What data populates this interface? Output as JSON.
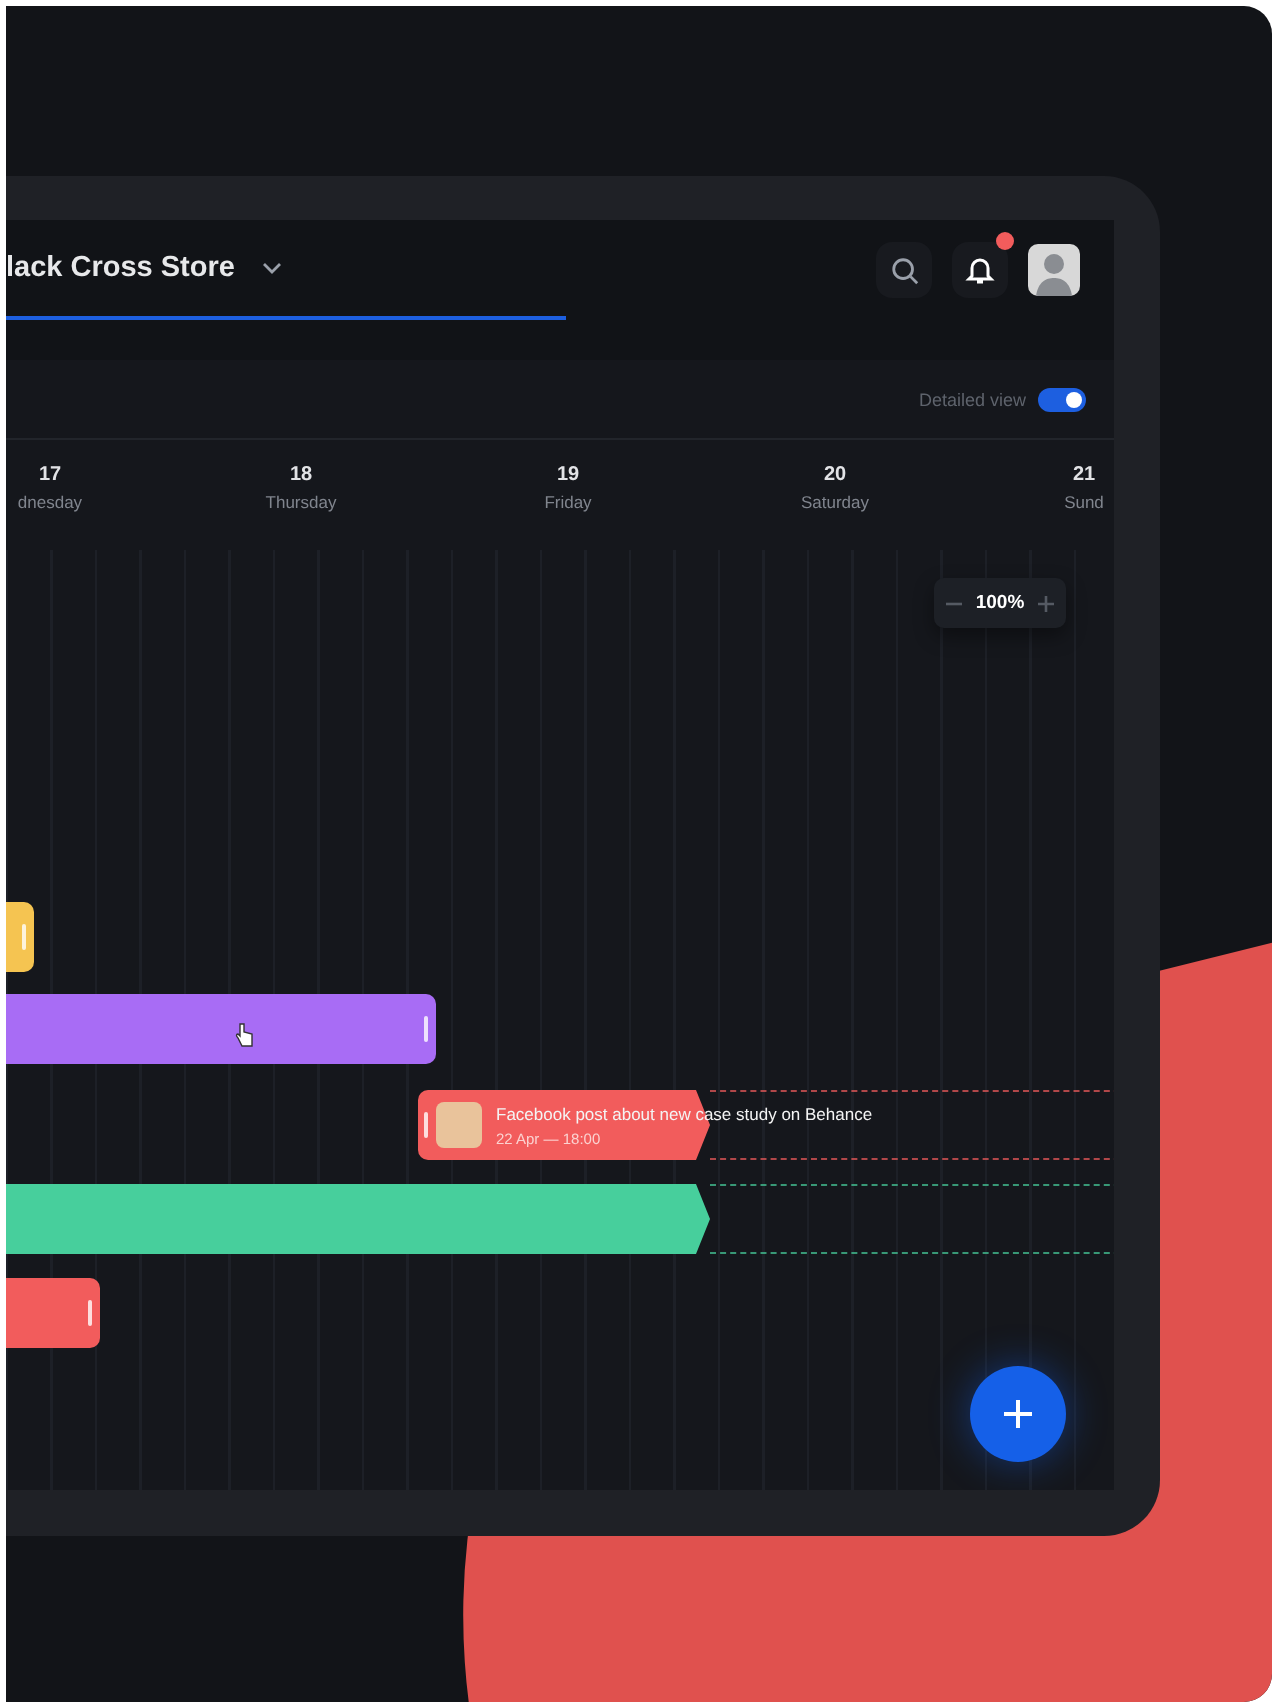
{
  "header": {
    "title": "lack Cross Store",
    "title_selected": true,
    "notifications_unread": true
  },
  "toolbar": {
    "toggle_label": "Detailed view",
    "toggle_on": true
  },
  "days": [
    {
      "number": "17",
      "name": "dnesday"
    },
    {
      "number": "18",
      "name": "Thursday"
    },
    {
      "number": "19",
      "name": "Friday"
    },
    {
      "number": "20",
      "name": "Saturday"
    },
    {
      "number": "21",
      "name": "Sund"
    }
  ],
  "zoom": {
    "value": "100%"
  },
  "events": [
    {
      "kind": "bar",
      "color": "#f5c451"
    },
    {
      "kind": "bar",
      "color": "#a86cf5"
    },
    {
      "kind": "post",
      "color": "#f25c5c",
      "title": "Facebook post about new case study on Behance",
      "time": "22 Apr — 18:00"
    },
    {
      "kind": "arrow",
      "color": "#47cf9c"
    },
    {
      "kind": "bar",
      "color": "#f25c5c"
    }
  ]
}
